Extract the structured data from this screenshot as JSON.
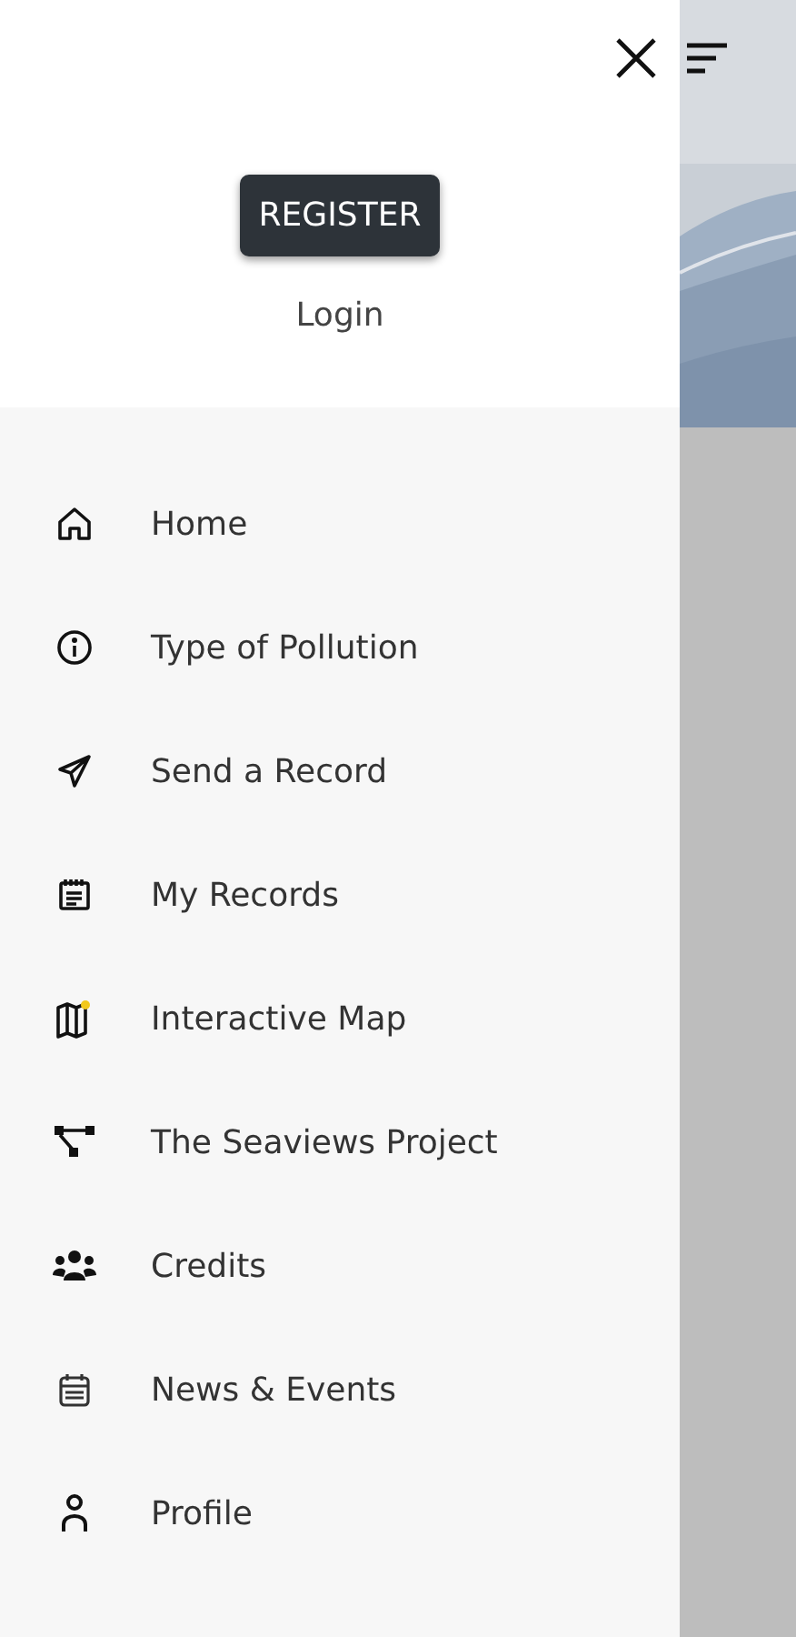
{
  "drawer": {
    "register_button": "REGISTER",
    "login_link": "Login",
    "menu": [
      {
        "label": "Home"
      },
      {
        "label": "Type of Pollution"
      },
      {
        "label": "Send a Record"
      },
      {
        "label": "My Records"
      },
      {
        "label": "Interactive Map"
      },
      {
        "label": "The Seaviews Project"
      },
      {
        "label": "Credits"
      },
      {
        "label": "News & Events"
      },
      {
        "label": "Profile"
      }
    ]
  }
}
